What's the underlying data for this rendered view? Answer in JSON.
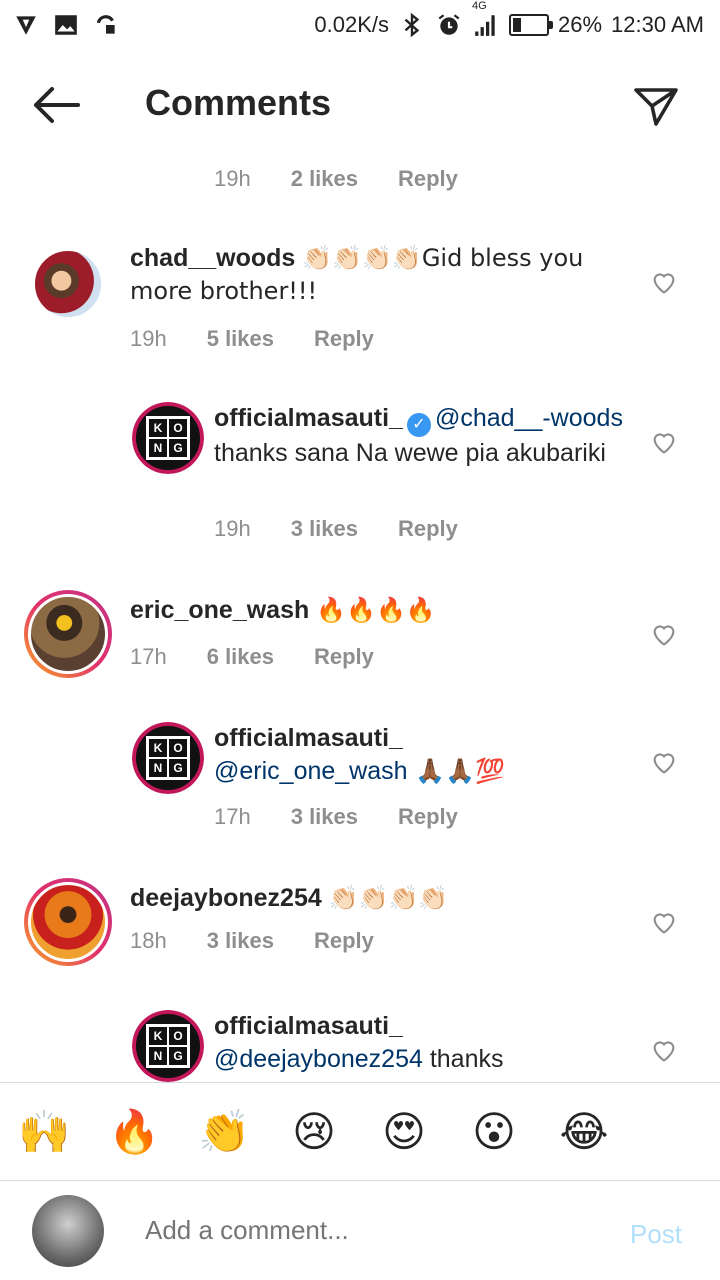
{
  "status": {
    "speed": "0.02K/s",
    "network": "4G",
    "battery": "26%",
    "battery_level": 0.26,
    "time": "12:30 AM"
  },
  "header": {
    "title": "Comments"
  },
  "top_meta": {
    "time": "19h",
    "likes": "2 likes",
    "reply": "Reply"
  },
  "comments": [
    {
      "username": "chad__woods",
      "text": "👏🏻👏🏻👏🏻👏🏻Gid bless you more brother!!!",
      "time": "19h",
      "likes": "5 likes",
      "reply": "Reply"
    },
    {
      "username": "officialmasauti_",
      "mention": "@chad__-woods",
      "text": " thanks sana Na wewe pia akubariki",
      "time": "19h",
      "likes": "3 likes",
      "reply": "Reply"
    },
    {
      "username": "eric_one_wash",
      "text": "🔥🔥🔥🔥",
      "time": "17h",
      "likes": "6 likes",
      "reply": "Reply"
    },
    {
      "username": "officialmasauti_",
      "mention": "@eric_one_wash",
      "text": " 🙏🏾🙏🏾💯",
      "time": "17h",
      "likes": "3 likes",
      "reply": "Reply"
    },
    {
      "username": "deejaybonez254",
      "text": "👏🏻👏🏻👏🏻👏🏻",
      "time": "18h",
      "likes": "3 likes",
      "reply": "Reply"
    },
    {
      "username": "officialmasauti_",
      "mention": "@deejaybonez254",
      "text": " thanks"
    }
  ],
  "emoji_bar": [
    "🙌",
    "🔥",
    "👏",
    "😢",
    "😍",
    "😮",
    "😂"
  ],
  "composer": {
    "placeholder": "Add a comment...",
    "post": "Post"
  },
  "colors": {
    "mention": "#003569",
    "meta": "#8e8e8e",
    "post": "#b2dffc",
    "verified": "#3897f0"
  }
}
